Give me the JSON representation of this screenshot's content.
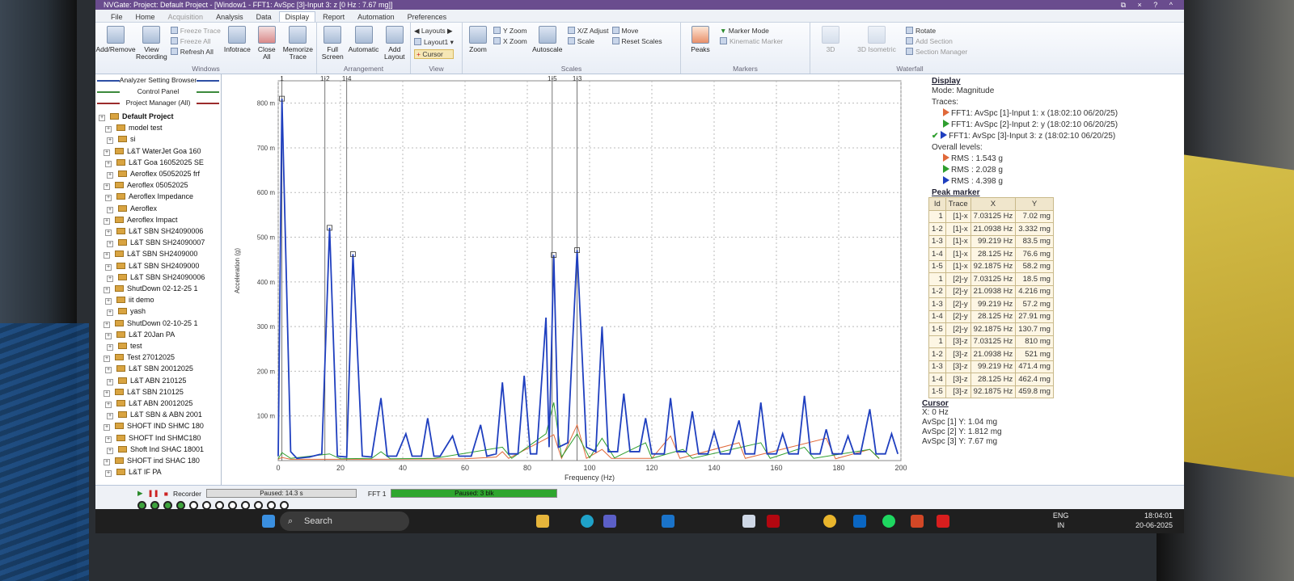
{
  "window": {
    "title": "NVGate: Project: Default Project - [Window1 - FFT1: AvSpc [3]-Input 3: z [0 Hz : 7.67 mg]]",
    "controls": "⧉ × ? ^"
  },
  "menu": {
    "file": "File",
    "tabs": [
      "Home",
      "Acquisition",
      "Analysis",
      "Data",
      "Display",
      "Report",
      "Automation",
      "Preferences"
    ],
    "active": "Display"
  },
  "ribbon": {
    "windows": {
      "name": "Windows",
      "add_remove": "Add/Remove",
      "view_recording": "View Recording",
      "freeze_trace": "Freeze Trace",
      "freeze_all": "Freeze All",
      "refresh_all": "Refresh All",
      "infotrace": "Infotrace",
      "close_all": "Close All",
      "memorize_trace": "Memorize Trace"
    },
    "arrangement": {
      "name": "Arrangement",
      "full_screen": "Full Screen",
      "automatic": "Automatic",
      "add_layout": "Add Layout"
    },
    "view": {
      "name": "View",
      "layouts": "Layouts",
      "layout1": "Layout1",
      "cursor": "Cursor"
    },
    "scales": {
      "name": "Scales",
      "zoom": "Zoom",
      "y_zoom": "Y Zoom",
      "x_zoom": "X Zoom",
      "autoscale": "Autoscale",
      "xz_adjust": "X/Z Adjust",
      "scale": "Scale",
      "move": "Move",
      "reset_scales": "Reset Scales"
    },
    "markers": {
      "name": "Markers",
      "peaks": "Peaks",
      "marker_mode": "Marker Mode",
      "kinematic_marker": "Kinematic Marker"
    },
    "waterfall": {
      "name": "Waterfall",
      "d3": "3D",
      "d3_isometric": "3D Isometric",
      "rotate": "Rotate",
      "add_section": "Add Section",
      "section_manager": "Section Manager"
    }
  },
  "left_panel": {
    "analyzer_setting_browser": "Analyzer Setting Browser",
    "control_panel": "Control Panel",
    "project_manager": "Project Manager (All)",
    "tree": [
      "Default Project",
      "model test",
      "si",
      "L&T WaterJet Goa 160",
      "L&T Goa 16052025 SE",
      "Aeroflex 05052025 frf",
      "Aeroflex 05052025",
      "Aeroflex Impedance",
      "Aeroflex",
      "Aeroflex Impact",
      "L&T SBN SH24090006",
      "L&T SBN SH24090007",
      "L&T SBN  SH2409000",
      "L&T SBN  SH2409000",
      "L&T SBN SH24090006",
      "ShutDown 02-12-25 1",
      "iit demo",
      "yash",
      "ShutDown 02-10-25 1",
      "L&T 20Jan PA",
      "test",
      "Test 27012025",
      "L&T SBN 20012025",
      "L&T ABN 210125",
      "L&T SBN 210125",
      "L&T  ABN 20012025",
      "L&T SBN & ABN 2001",
      "SHOFT IND SHMC 180",
      "SHOFT Ind SHMC180",
      "Shoft Ind SHAC 18001",
      "SHOFT ind SHAC 180",
      "L&T IF PA"
    ]
  },
  "chart_data": {
    "type": "line",
    "xlabel": "Frequency (Hz)",
    "ylabel": "Acceleration (g)",
    "xlim": [
      0,
      200
    ],
    "ylim": [
      0,
      850
    ],
    "x_ticks": [
      "0",
      "20",
      "40",
      "60",
      "80",
      "100",
      "120",
      "140",
      "160",
      "180",
      "200"
    ],
    "y_ticks": [
      "100 m",
      "200 m",
      "300 m",
      "400 m",
      "500 m",
      "600 m",
      "700 m",
      "800 m"
    ],
    "grid": true,
    "marker_lines": [
      {
        "label": "1",
        "x": 1.2
      },
      {
        "label": "1-2",
        "x": 15
      },
      {
        "label": "1-4",
        "x": 22
      },
      {
        "label": "1-5",
        "x": 88
      },
      {
        "label": "1-3",
        "x": 96
      }
    ],
    "peaks": [
      {
        "x": 1.2,
        "y": 810
      },
      {
        "x": 16.5,
        "y": 521
      },
      {
        "x": 24,
        "y": 462
      },
      {
        "x": 88.5,
        "y": 460
      },
      {
        "x": 96,
        "y": 471
      }
    ],
    "series": [
      {
        "name": "FFT1: AvSpc [3]-Input 3: z",
        "color": "#1f3fbf",
        "points": [
          [
            0,
            10
          ],
          [
            1.2,
            810
          ],
          [
            4,
            20
          ],
          [
            6,
            5
          ],
          [
            10,
            8
          ],
          [
            14,
            15
          ],
          [
            16.5,
            521
          ],
          [
            19,
            10
          ],
          [
            22,
            8
          ],
          [
            24,
            462
          ],
          [
            27,
            10
          ],
          [
            30,
            8
          ],
          [
            33,
            140
          ],
          [
            35,
            10
          ],
          [
            38,
            10
          ],
          [
            41,
            60
          ],
          [
            43,
            10
          ],
          [
            46,
            10
          ],
          [
            48,
            95
          ],
          [
            50,
            10
          ],
          [
            52,
            10
          ],
          [
            56,
            55
          ],
          [
            58,
            10
          ],
          [
            62,
            10
          ],
          [
            65,
            80
          ],
          [
            67,
            10
          ],
          [
            70,
            15
          ],
          [
            72,
            175
          ],
          [
            74,
            15
          ],
          [
            77,
            15
          ],
          [
            79,
            190
          ],
          [
            81,
            15
          ],
          [
            83,
            15
          ],
          [
            86,
            320
          ],
          [
            87,
            30
          ],
          [
            88.5,
            460
          ],
          [
            90,
            30
          ],
          [
            93,
            40
          ],
          [
            96,
            471
          ],
          [
            99,
            30
          ],
          [
            102,
            20
          ],
          [
            104,
            300
          ],
          [
            106,
            20
          ],
          [
            109,
            20
          ],
          [
            111,
            150
          ],
          [
            113,
            20
          ],
          [
            116,
            20
          ],
          [
            118,
            95
          ],
          [
            120,
            15
          ],
          [
            124,
            15
          ],
          [
            126,
            140
          ],
          [
            128,
            20
          ],
          [
            131,
            20
          ],
          [
            133,
            110
          ],
          [
            135,
            15
          ],
          [
            138,
            15
          ],
          [
            140,
            65
          ],
          [
            142,
            15
          ],
          [
            145,
            15
          ],
          [
            148,
            90
          ],
          [
            150,
            15
          ],
          [
            153,
            15
          ],
          [
            155,
            130
          ],
          [
            157,
            15
          ],
          [
            160,
            15
          ],
          [
            162,
            60
          ],
          [
            164,
            15
          ],
          [
            167,
            15
          ],
          [
            169,
            145
          ],
          [
            171,
            15
          ],
          [
            174,
            15
          ],
          [
            176,
            70
          ],
          [
            178,
            15
          ],
          [
            181,
            15
          ],
          [
            183,
            55
          ],
          [
            185,
            15
          ],
          [
            187,
            15
          ],
          [
            190,
            115
          ],
          [
            192,
            15
          ],
          [
            195,
            15
          ],
          [
            197,
            60
          ],
          [
            199,
            15
          ],
          [
            202,
            10
          ],
          [
            205,
            70
          ],
          [
            207,
            10
          ],
          [
            210,
            10
          ]
        ]
      },
      {
        "name": "FFT1: AvSpc [2]-Input 2: y",
        "color": "#2e9e2e",
        "points": [
          [
            0,
            4
          ],
          [
            1.2,
            18
          ],
          [
            4,
            5
          ],
          [
            16.5,
            15
          ],
          [
            20,
            4
          ],
          [
            30,
            5
          ],
          [
            33,
            20
          ],
          [
            36,
            4
          ],
          [
            50,
            5
          ],
          [
            72,
            30
          ],
          [
            75,
            5
          ],
          [
            86,
            60
          ],
          [
            88.5,
            130
          ],
          [
            91,
            8
          ],
          [
            96,
            60
          ],
          [
            100,
            6
          ],
          [
            104,
            50
          ],
          [
            108,
            6
          ],
          [
            118,
            40
          ],
          [
            120,
            5
          ],
          [
            130,
            25
          ],
          [
            133,
            5
          ],
          [
            155,
            40
          ],
          [
            158,
            5
          ],
          [
            169,
            30
          ],
          [
            172,
            5
          ],
          [
            190,
            25
          ],
          [
            193,
            5
          ],
          [
            210,
            5
          ]
        ]
      },
      {
        "name": "FFT1: AvSpc [1]-Input 1: x",
        "color": "#e0693a",
        "points": [
          [
            0,
            3
          ],
          [
            1.2,
            7
          ],
          [
            4,
            3
          ],
          [
            30,
            3
          ],
          [
            60,
            4
          ],
          [
            70,
            8
          ],
          [
            72,
            20
          ],
          [
            74,
            5
          ],
          [
            88.5,
            58
          ],
          [
            91,
            5
          ],
          [
            96,
            80
          ],
          [
            99,
            5
          ],
          [
            104,
            25
          ],
          [
            107,
            5
          ],
          [
            120,
            5
          ],
          [
            126,
            55
          ],
          [
            129,
            5
          ],
          [
            148,
            40
          ],
          [
            150,
            5
          ],
          [
            176,
            50
          ],
          [
            179,
            4
          ],
          [
            190,
            25
          ],
          [
            193,
            4
          ],
          [
            210,
            3
          ]
        ]
      }
    ]
  },
  "display": {
    "heading": "Display",
    "mode": "Mode: Magnitude",
    "traces_label": "Traces:",
    "traces": [
      {
        "text": "FFT1: AvSpc [1]-Input 1: x (18:02:10 06/20/25)",
        "color": "#e0693a"
      },
      {
        "text": "FFT1: AvSpc [2]-Input 2: y (18:02:10 06/20/25)",
        "color": "#2e9e2e"
      },
      {
        "text": "FFT1: AvSpc [3]-Input 3: z (18:02:10 06/20/25)",
        "color": "#1f3fbf"
      }
    ],
    "overall_label": "Overall levels:",
    "rms": [
      {
        "text": "RMS : 1.543 g",
        "color": "#e0693a"
      },
      {
        "text": "RMS : 2.028 g",
        "color": "#2e9e2e"
      },
      {
        "text": "RMS : 4.398 g",
        "color": "#1f3fbf"
      }
    ]
  },
  "peak_marker": {
    "heading": "Peak marker",
    "columns": [
      "Id",
      "Trace",
      "X",
      "Y"
    ],
    "rows": [
      [
        "1",
        "[1]-x",
        "7.03125 Hz",
        "7.02 mg"
      ],
      [
        "1-2",
        "[1]-x",
        "21.0938 Hz",
        "3.332 mg"
      ],
      [
        "1-3",
        "[1]-x",
        "99.219 Hz",
        "83.5 mg"
      ],
      [
        "1-4",
        "[1]-x",
        "28.125 Hz",
        "76.6 mg"
      ],
      [
        "1-5",
        "[1]-x",
        "92.1875 Hz",
        "58.2 mg"
      ],
      [
        "1",
        "[2]-y",
        "7.03125 Hz",
        "18.5 mg"
      ],
      [
        "1-2",
        "[2]-y",
        "21.0938 Hz",
        "4.216 mg"
      ],
      [
        "1-3",
        "[2]-y",
        "99.219 Hz",
        "57.2 mg"
      ],
      [
        "1-4",
        "[2]-y",
        "28.125 Hz",
        "27.91 mg"
      ],
      [
        "1-5",
        "[2]-y",
        "92.1875 Hz",
        "130.7 mg"
      ],
      [
        "1",
        "[3]-z",
        "7.03125 Hz",
        "810 mg"
      ],
      [
        "1-2",
        "[3]-z",
        "21.0938 Hz",
        "521 mg"
      ],
      [
        "1-3",
        "[3]-z",
        "99.219 Hz",
        "471.4 mg"
      ],
      [
        "1-4",
        "[3]-z",
        "28.125 Hz",
        "462.4 mg"
      ],
      [
        "1-5",
        "[3]-z",
        "92.1875 Hz",
        "459.8 mg"
      ]
    ]
  },
  "cursor": {
    "heading": "Cursor",
    "x": "X: 0 Hz",
    "lines": [
      "AvSpc [1] Y: 1.04 mg",
      "AvSpc [2] Y: 1.812 mg",
      "AvSpc [3] Y: 7.67 mg"
    ]
  },
  "status": {
    "recorder": "Recorder",
    "paused_time": "Paused: 14.3 s",
    "fft": "FFT 1",
    "fft_status": "Paused: 3 blk"
  },
  "taskbar": {
    "search": "Search",
    "lang": "ENG",
    "region": "IN",
    "time": "18:04:01",
    "date": "20-06-2025"
  }
}
